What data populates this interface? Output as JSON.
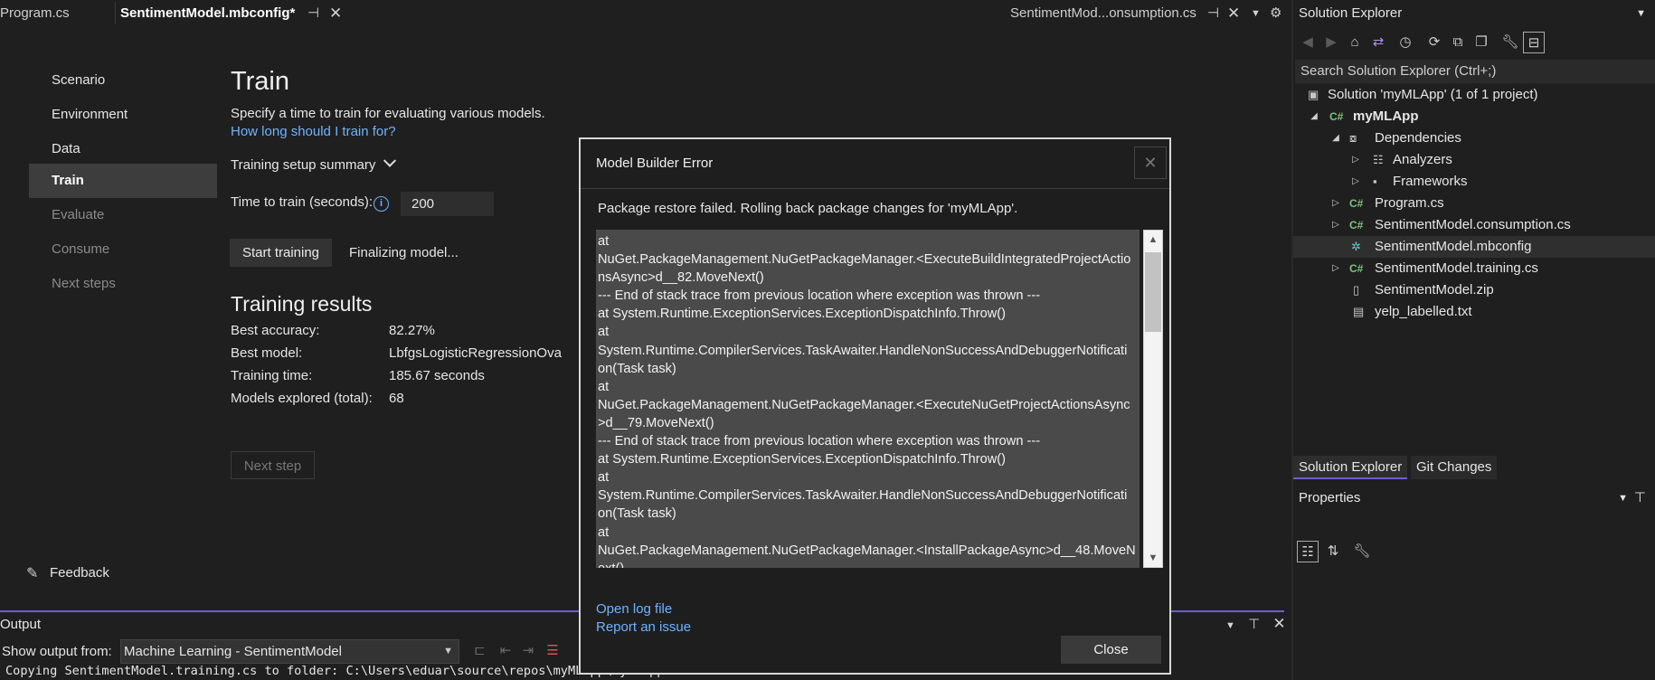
{
  "tabs": {
    "program": "Program.cs",
    "mbconfig": "SentimentModel.mbconfig*",
    "consumption": "SentimentMod...onsumption.cs"
  },
  "nav": {
    "items": [
      {
        "label": "Scenario",
        "state": "normal"
      },
      {
        "label": "Environment",
        "state": "normal"
      },
      {
        "label": "Data",
        "state": "normal"
      },
      {
        "label": "Train",
        "state": "selected"
      },
      {
        "label": "Evaluate",
        "state": "disabled"
      },
      {
        "label": "Consume",
        "state": "disabled"
      },
      {
        "label": "Next steps",
        "state": "disabled"
      }
    ],
    "feedback": "Feedback"
  },
  "train": {
    "title": "Train",
    "description": "Specify a time to train for evaluating various models.",
    "help_link": "How long should I train for?",
    "summary_label": "Training setup summary",
    "time_label": "Time to train (seconds):",
    "time_value": "200",
    "start_button": "Start training",
    "status": "Finalizing model...",
    "results_title": "Training results",
    "results": [
      {
        "label": "Best accuracy:",
        "value": "82.27%"
      },
      {
        "label": "Best model:",
        "value": "LbfgsLogisticRegressionOva"
      },
      {
        "label": "Training time:",
        "value": "185.67 seconds"
      },
      {
        "label": "Models explored (total):",
        "value": "68"
      }
    ],
    "next_step": "Next step"
  },
  "dialog": {
    "title": "Model Builder Error",
    "message": "Package restore failed. Rolling back package changes for 'myMLApp'.",
    "trace_lines": [
      "   at",
      "NuGet.PackageManagement.NuGetPackageManager.<ExecuteBuildIntegratedProjectActio",
      "nsAsync>d__82.MoveNext()",
      "--- End of stack trace from previous location where exception was thrown ---",
      "   at System.Runtime.ExceptionServices.ExceptionDispatchInfo.Throw()",
      "   at",
      "System.Runtime.CompilerServices.TaskAwaiter.HandleNonSuccessAndDebuggerNotificati",
      "on(Task task)",
      "   at",
      "NuGet.PackageManagement.NuGetPackageManager.<ExecuteNuGetProjectActionsAsync",
      ">d__79.MoveNext()",
      "--- End of stack trace from previous location where exception was thrown ---",
      "   at System.Runtime.ExceptionServices.ExceptionDispatchInfo.Throw()",
      "   at",
      "System.Runtime.CompilerServices.TaskAwaiter.HandleNonSuccessAndDebuggerNotificati",
      "on(Task task)",
      "   at",
      "NuGet.PackageManagement.NuGetPackageManager.<InstallPackageAsync>d__48.MoveN",
      "ext()"
    ],
    "open_log": "Open log file",
    "report_issue": "Report an issue",
    "close_button": "Close"
  },
  "output": {
    "title": "Output",
    "show_from_label": "Show output from:",
    "source": "Machine Learning - SentimentModel",
    "log_line": "Copying SentimentModel.training.cs to folder: C:\\Users\\eduar\\source\\repos\\myMLApp\\myMLApp"
  },
  "solution_explorer": {
    "title": "Solution Explorer",
    "search_placeholder": "Search Solution Explorer (Ctrl+;)",
    "tree": [
      {
        "label": "Solution 'myMLApp' (1 of 1 project)",
        "depth": 0,
        "expander": "",
        "icon": "solution-icon"
      },
      {
        "label": "myMLApp",
        "depth": 1,
        "expander": "expanded",
        "icon": "csharp-project-icon"
      },
      {
        "label": "Dependencies",
        "depth": 2,
        "expander": "expanded",
        "icon": "dependencies-icon"
      },
      {
        "label": "Analyzers",
        "depth": 3,
        "expander": "collapsed",
        "icon": "analyzers-icon"
      },
      {
        "label": "Frameworks",
        "depth": 3,
        "expander": "collapsed",
        "icon": "frameworks-icon"
      },
      {
        "label": "Program.cs",
        "depth": 2,
        "expander": "collapsed",
        "icon": "csharp-file-icon"
      },
      {
        "label": "SentimentModel.consumption.cs",
        "depth": 2,
        "expander": "collapsed",
        "icon": "csharp-file-icon"
      },
      {
        "label": "SentimentModel.mbconfig",
        "depth": 2,
        "expander": "",
        "icon": "mbconfig-icon",
        "selected": true
      },
      {
        "label": "SentimentModel.training.cs",
        "depth": 2,
        "expander": "collapsed",
        "icon": "csharp-file-icon"
      },
      {
        "label": "SentimentModel.zip",
        "depth": 2,
        "expander": "",
        "icon": "zip-file-icon"
      },
      {
        "label": "yelp_labelled.txt",
        "depth": 2,
        "expander": "",
        "icon": "text-file-icon"
      }
    ],
    "tabs": [
      "Solution Explorer",
      "Git Changes"
    ],
    "properties_title": "Properties"
  },
  "colors": {
    "accent": "#6b5ed1",
    "link": "#6fb3ff",
    "background": "#1f1f1f",
    "selected_nav": "#3d3d3d"
  }
}
